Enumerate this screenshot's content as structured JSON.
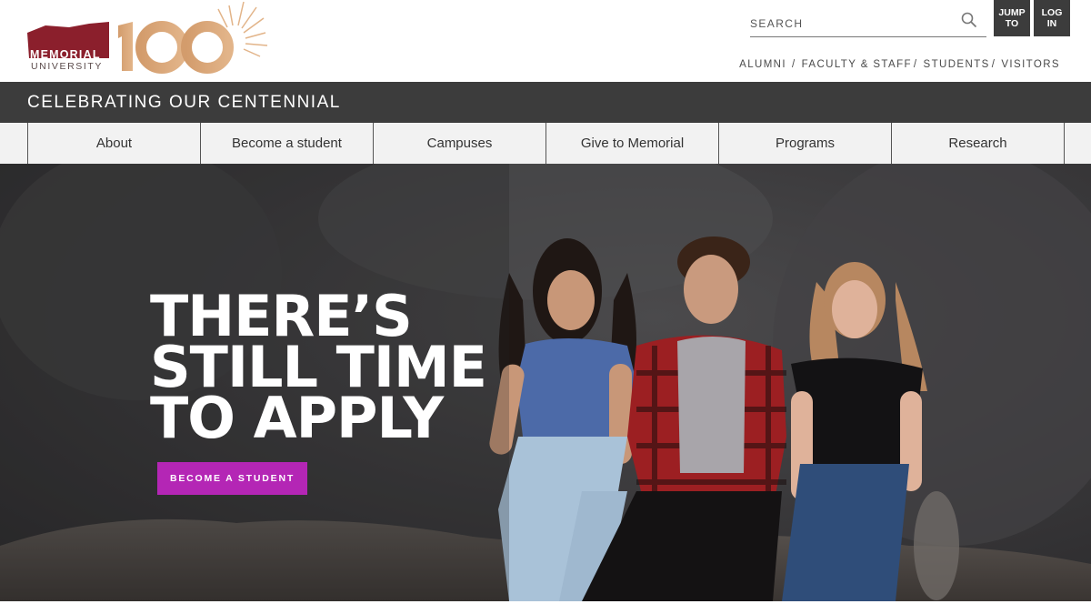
{
  "header": {
    "logo": {
      "wordmark_line1": "MEMORIAL",
      "wordmark_line2": "UNIVERSITY",
      "centennial_number": "100",
      "icon": "memorial-university-centennial-logo"
    },
    "search": {
      "placeholder": "SEARCH",
      "value": "",
      "icon": "search-icon"
    },
    "jump_to": {
      "line1": "JUMP",
      "line2": "TO"
    },
    "log_in": {
      "line1": "LOG",
      "line2": "IN"
    },
    "audience_links": [
      {
        "label": "ALUMNI"
      },
      {
        "label": "FACULTY & STAFF"
      },
      {
        "label": "STUDENTS"
      },
      {
        "label": "VISITORS"
      }
    ],
    "separator": "/"
  },
  "banner": {
    "title": "CELEBRATING OUR CENTENNIAL"
  },
  "nav": {
    "items": [
      {
        "label": "About"
      },
      {
        "label": "Become a student"
      },
      {
        "label": "Campuses"
      },
      {
        "label": "Give to Memorial"
      },
      {
        "label": "Programs"
      },
      {
        "label": "Research"
      }
    ]
  },
  "hero": {
    "headline_lines": [
      "THERE’S",
      "STILL TIME",
      "TO APPLY"
    ],
    "cta_label": "BECOME A STUDENT",
    "image_description": "three-students-sitting-on-rock"
  },
  "colors": {
    "brand_maroon": "#8b1f2c",
    "gold": "#d9a56c",
    "dark_bar": "#3c3c3c",
    "nav_bg": "#f2f2f2",
    "cta_magenta": "#b426b5"
  }
}
